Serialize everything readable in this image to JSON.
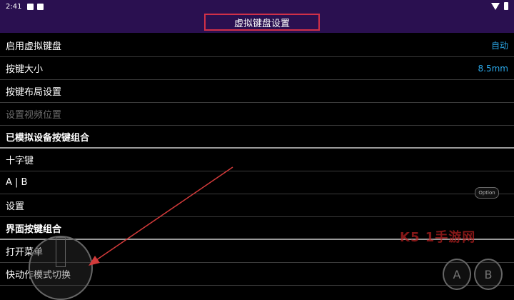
{
  "status": {
    "time": "2:41"
  },
  "title": "虚拟键盘设置",
  "rows": [
    {
      "label": "启用虚拟键盘",
      "value": "自动"
    },
    {
      "label": "按键大小",
      "value": "8.5mm"
    },
    {
      "label": "按键布局设置",
      "value": ""
    },
    {
      "label": "设置视频位置",
      "value": ""
    },
    {
      "label": "已模拟设备按键组合",
      "value": ""
    },
    {
      "label": "十字键",
      "value": ""
    },
    {
      "label": "A | B",
      "value": ""
    },
    {
      "label": "设置",
      "value": ""
    },
    {
      "label": "界面按键组合",
      "value": ""
    },
    {
      "label": "打开菜单",
      "value": ""
    },
    {
      "label": "快动作模式切换",
      "value": ""
    }
  ],
  "overlay": {
    "option_label": "Option",
    "a_label": "A",
    "b_label": "B",
    "watermark": "K5 1手游网"
  },
  "colors": {
    "accent": "#2aa6e6",
    "title_bg": "#2a1050",
    "highlight": "#d03048",
    "arrow": "#d23a3a"
  }
}
